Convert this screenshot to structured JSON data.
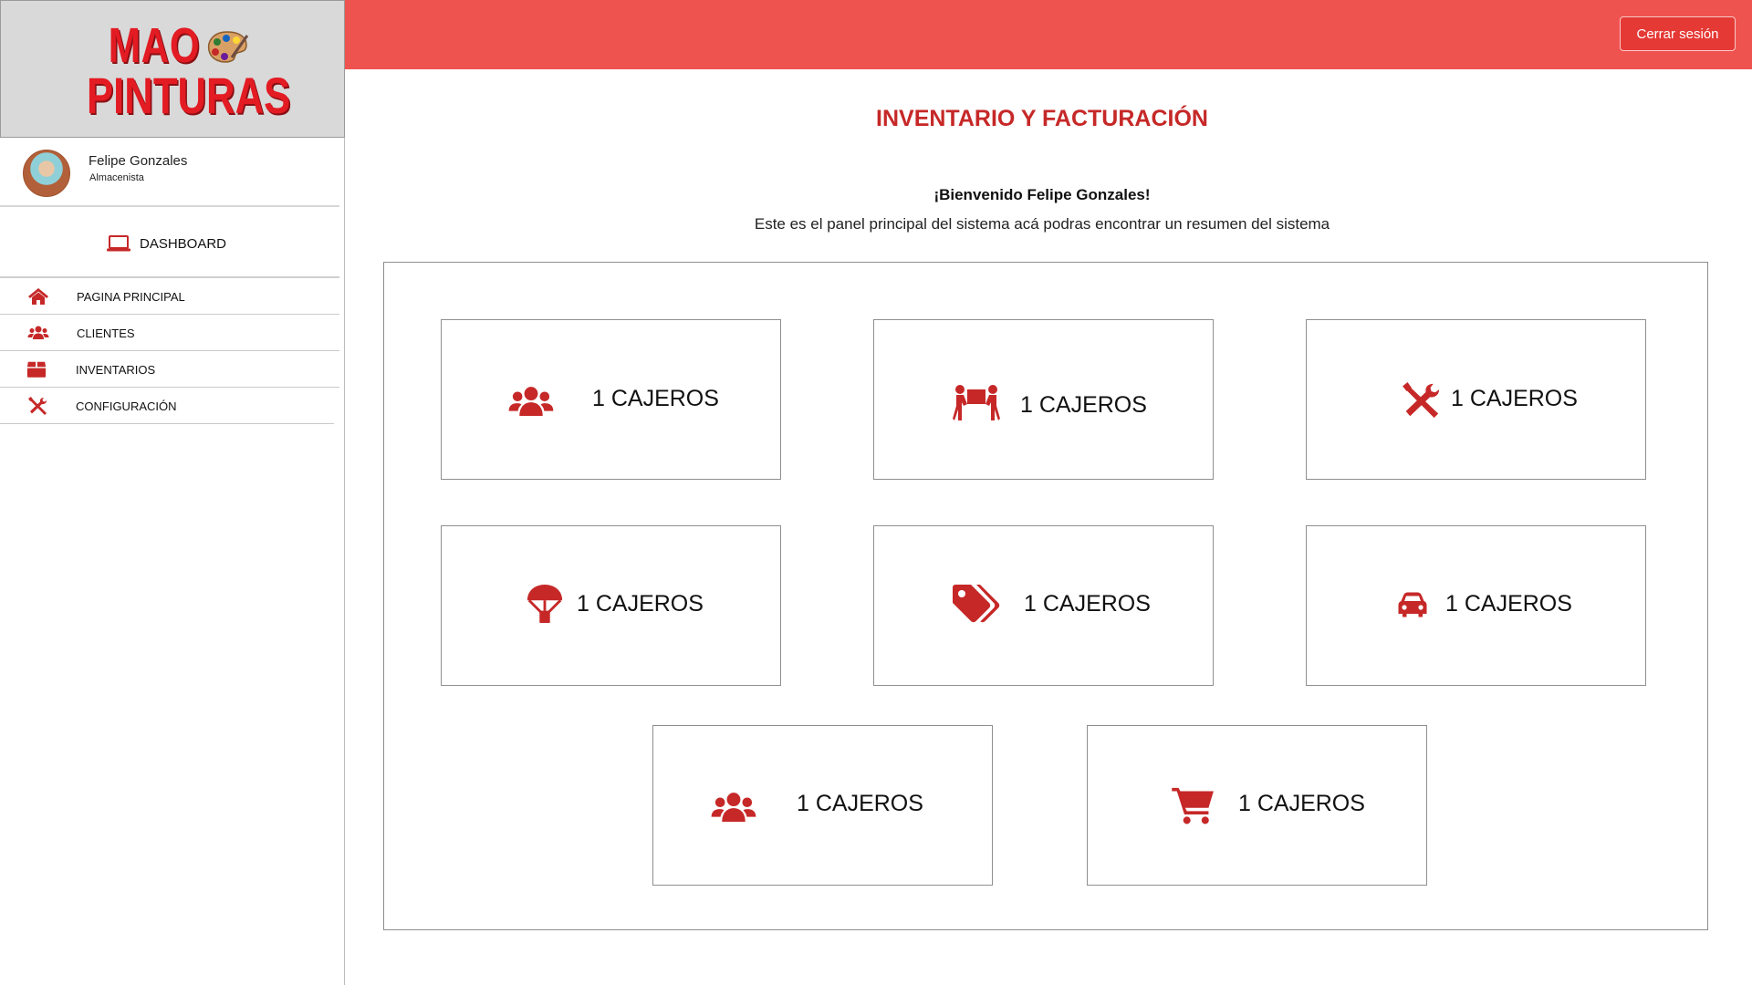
{
  "brand": {
    "line1": "MAO",
    "line2": "PINTURAS",
    "accent_color": "#e31b23"
  },
  "user": {
    "name": "Felipe Gonzales",
    "role": "Almacenista"
  },
  "sidebar": {
    "dashboard_label": "DASHBOARD",
    "items": [
      {
        "label": "PAGINA PRINCIPAL",
        "icon": "home-icon"
      },
      {
        "label": "CLIENTES",
        "icon": "users-icon"
      },
      {
        "label": "INVENTARIOS",
        "icon": "box-icon"
      },
      {
        "label": "CONFIGURACIÓN",
        "icon": "tools-icon"
      }
    ]
  },
  "header": {
    "logout_label": "Cerrar sesión",
    "bar_color": "#ef5350"
  },
  "main": {
    "title": "INVENTARIO Y FACTURACIÓN",
    "welcome": "¡Bienvenido Felipe Gonzales!",
    "subtitle": "Este es el panel principal del sistema acá podras encontrar un resumen del sistema"
  },
  "cards": [
    {
      "label": "1 CAJEROS",
      "icon": "users-icon"
    },
    {
      "label": "1 CAJEROS",
      "icon": "people-carry-icon"
    },
    {
      "label": "1 CAJEROS",
      "icon": "tools-icon"
    },
    {
      "label": "1 CAJEROS",
      "icon": "parachute-box-icon"
    },
    {
      "label": "1 CAJEROS",
      "icon": "tags-icon"
    },
    {
      "label": "1 CAJEROS",
      "icon": "car-icon"
    },
    {
      "label": "1 CAJEROS",
      "icon": "users-icon"
    },
    {
      "label": "1 CAJEROS",
      "icon": "cart-icon"
    }
  ],
  "icon_color": "#c62828"
}
